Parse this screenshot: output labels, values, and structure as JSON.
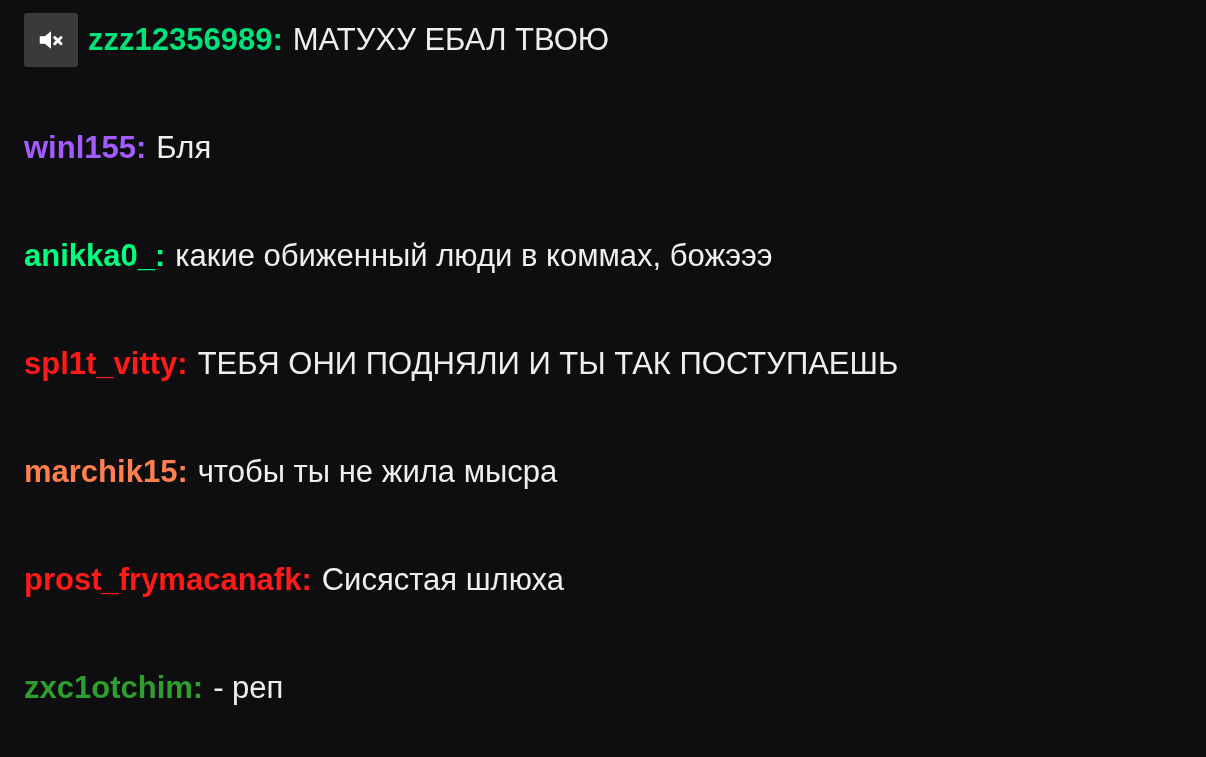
{
  "messages": [
    {
      "kind": "muted",
      "user": "zzz12356989:",
      "color": "#00e27a",
      "text": "МАТУХУ ЕБАЛ ТВОЮ"
    },
    {
      "kind": "plain",
      "user": "winl155:",
      "color": "#a35cff",
      "text": "Бля"
    },
    {
      "kind": "plain",
      "user": "anikka0_:",
      "color": "#00ff7f",
      "text": "какие обиженный люди в коммах, божэээ"
    },
    {
      "kind": "plain",
      "user": "spl1t_vitty:",
      "color": "#ff1a1a",
      "text": "ТЕБЯ ОНИ ПОДНЯЛИ И ТЫ ТАК ПОСТУПАЕШЬ"
    },
    {
      "kind": "plain",
      "user": "marchik15:",
      "color": "#ff7f50",
      "text": "чтобы ты не жила мысра"
    },
    {
      "kind": "plain",
      "user": "prost_frymacanafk:",
      "color": "#ff1a1a",
      "text": "Сисястая шлюха"
    },
    {
      "kind": "plain",
      "user": "zxc1otchim:",
      "color": "#2f9e2f",
      "text": "- реп"
    }
  ]
}
